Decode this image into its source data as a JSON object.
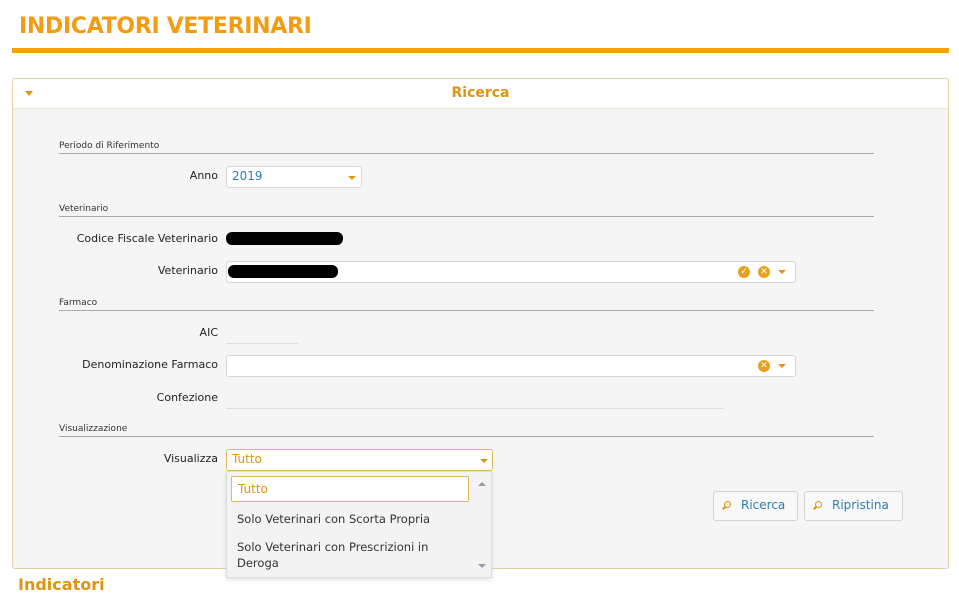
{
  "page": {
    "title": "INDICATORI VETERINARI"
  },
  "search_panel": {
    "title": "Ricerca",
    "sections": {
      "period": "Periodo di Riferimento",
      "vet": "Veterinario",
      "drug": "Farmaco",
      "view": "Visualizzazione"
    },
    "fields": {
      "anno_label": "Anno",
      "anno_value": "2019",
      "cf_label": "Codice Fiscale Veterinario",
      "vet_label": "Veterinario",
      "aic_label": "AIC",
      "denominazione_label": "Denominazione Farmaco",
      "confezione_label": "Confezione",
      "visualizza_label": "Visualizza",
      "visualizza_value": "Tutto"
    },
    "visualizza_options": [
      "Tutto",
      "Solo Veterinari con Scorta Propria",
      "Solo Veterinari con Prescrizioni in Deroga"
    ],
    "buttons": {
      "ricerca": "Ricerca",
      "ripristina": "Ripristina"
    }
  },
  "next_section": {
    "title": "Indicatori"
  },
  "colors": {
    "accent": "#f5a30b",
    "link": "#2a7fb5"
  }
}
